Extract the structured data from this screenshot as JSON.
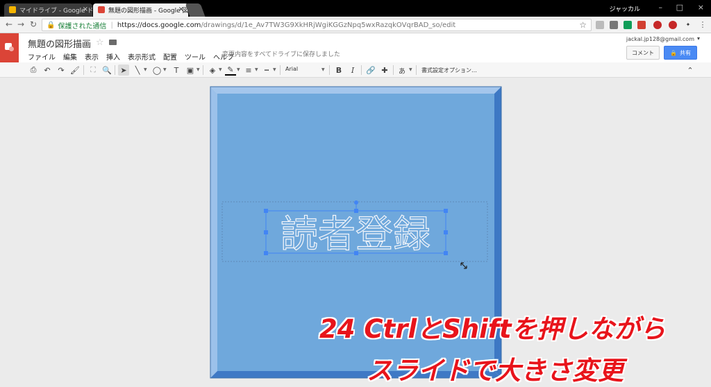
{
  "browser": {
    "tabs": [
      {
        "label": "マイドライブ - Google ドライブ",
        "favicon_color": "#f4b400"
      },
      {
        "label": "無題の図形描画 - Google 図形描画",
        "favicon_color": "#db4437"
      }
    ],
    "profile_name": "ジャッカル",
    "security_label": "保護された通信",
    "url_host": "https://docs.google.com",
    "url_path": "/drawings/d/1e_Av7TW3G9XkHRjWgiKGGzNpq5wxRazqkOVqrBAD_so/edit"
  },
  "app": {
    "title": "無題の図形描画",
    "menus": [
      "ファイル",
      "編集",
      "表示",
      "挿入",
      "表示形式",
      "配置",
      "ツール",
      "ヘルプ"
    ],
    "save_status": "変更内容をすべてドライブに保存しました",
    "account_email": "jackal.jp128@gmail.com",
    "comment_label": "コメント",
    "share_label": "共有",
    "brand_color": "#db4437",
    "share_color": "#4a8af4"
  },
  "toolbar": {
    "font": "Arial",
    "bold": "B",
    "italic": "I",
    "format_options": "書式設定オプション…",
    "text_direction": "あ"
  },
  "canvas": {
    "shape_fill": "#6fa8dc",
    "text": "読者登録"
  },
  "overlay": {
    "caption_line1": "24 CtrlとShiftを押しながら",
    "caption_line2": "スライドで大きさ変更"
  }
}
